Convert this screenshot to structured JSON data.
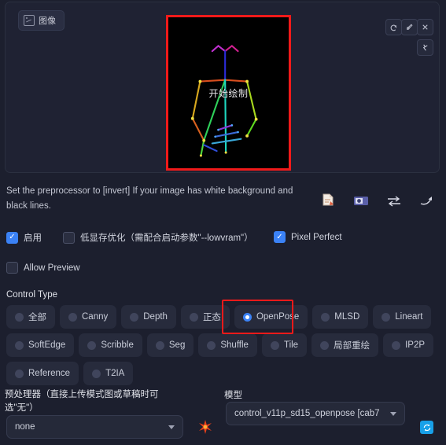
{
  "panel": {
    "image_tab_label": "图像",
    "image_tab_icon": "image-icon"
  },
  "preview": {
    "overlay_text": "开始绘制",
    "selection_color": "#f01a1a",
    "background": "#000000",
    "tools": [
      {
        "name": "undo-icon",
        "glyph": "↺"
      },
      {
        "name": "edit-icon",
        "glyph": "✑"
      },
      {
        "name": "close-icon",
        "glyph": "✕"
      },
      {
        "name": "pose-editor-icon",
        "glyph": "⚡"
      }
    ]
  },
  "hint": {
    "text": "Set the preprocessor to [invert] If your image has white background and black lines."
  },
  "quick_icons": [
    {
      "name": "file-upload-icon"
    },
    {
      "name": "camera-icon"
    },
    {
      "name": "swap-icon"
    },
    {
      "name": "arrow-icon"
    }
  ],
  "checkboxes": [
    {
      "name": "enable",
      "label": "启用",
      "checked": true
    },
    {
      "name": "lowvram",
      "label": "低显存优化（需配合启动参数\"--lowvram\"）",
      "checked": false
    },
    {
      "name": "pixel-perfect",
      "label": "Pixel Perfect",
      "checked": true
    },
    {
      "name": "allow-preview",
      "label": "Allow Preview",
      "checked": false
    }
  ],
  "control_type": {
    "title": "Control Type",
    "selected": "OpenPose",
    "rows": [
      [
        "全部",
        "Canny",
        "Depth",
        "正态",
        "OpenPose",
        "MLSD",
        "Lineart"
      ],
      [
        "SoftEdge",
        "Scribble",
        "Seg",
        "Shuffle",
        "Tile",
        "局部重绘",
        "IP2P"
      ],
      [
        "Reference",
        "T2IA"
      ]
    ]
  },
  "preprocessor": {
    "label": "预处理器（直接上传模式图或草稿时可选\"无\"）",
    "value": "none",
    "star_icon": "star-burst-icon"
  },
  "model": {
    "label": "模型",
    "value": "control_v11p_sd15_openpose [cab7",
    "refresh_icon": "refresh-icon"
  },
  "colors": {
    "accent_blue": "#3b82f6",
    "annotation_red": "#f01a1a",
    "refresh_blue": "#18a0e8",
    "background": "#1c1f2e"
  }
}
